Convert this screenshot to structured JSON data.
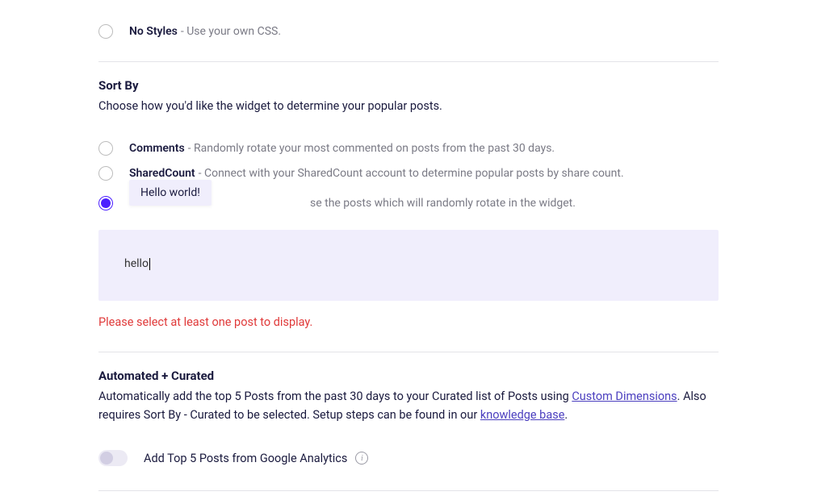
{
  "styles": {
    "options": [
      {
        "label": "No Styles",
        "desc": "- Use your own CSS."
      }
    ]
  },
  "sortBy": {
    "title": "Sort By",
    "desc": "Choose how you'd like the widget to determine your popular posts.",
    "options": [
      {
        "label": "Comments",
        "desc": "- Randomly rotate your most commented on posts from the past 30 days."
      },
      {
        "label": "SharedCount",
        "desc": "- Connect with your SharedCount account to determine popular posts by share count."
      },
      {
        "label": "",
        "desc": "se the posts which will randomly rotate in the widget."
      }
    ],
    "tag_text": "Hello world!",
    "input_value": "hello",
    "error": "Please select at least one post to display."
  },
  "automated": {
    "title": "Automated + Curated",
    "desc_pre": "Automatically add the top 5 Posts from the past 30 days to your Curated list of Posts using ",
    "link1": "Custom Dimensions",
    "desc_mid": ". Also requires Sort By - Curated to be selected. Setup steps can be found in our ",
    "link2": "knowledge base",
    "desc_post": ".",
    "toggle_label": "Add Top 5 Posts from Google Analytics"
  }
}
